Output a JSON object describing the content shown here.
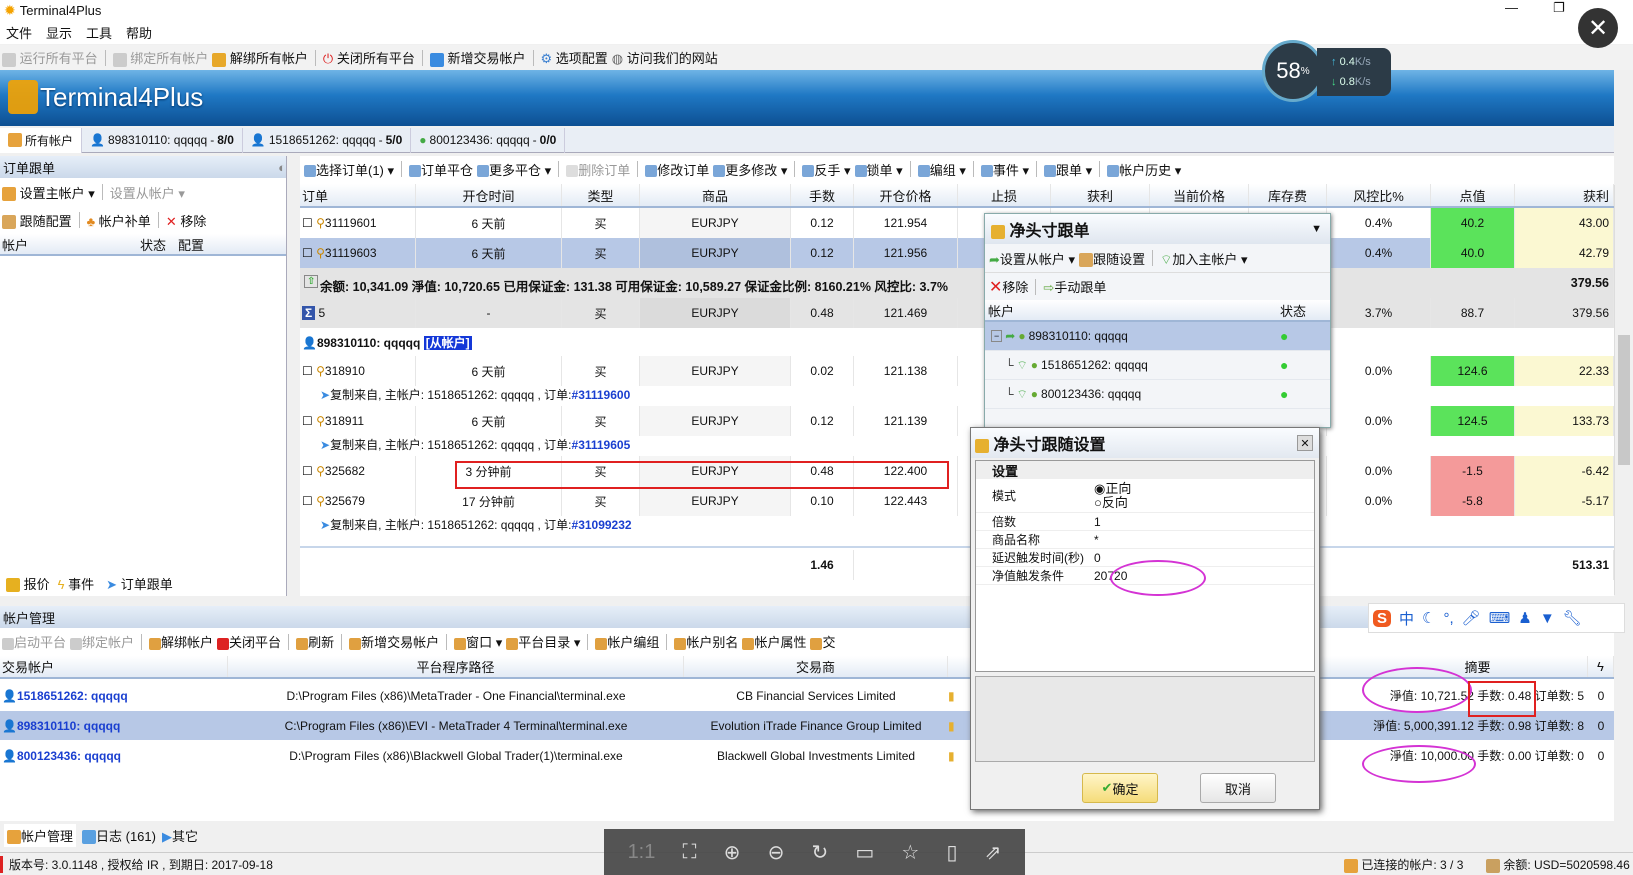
{
  "window": {
    "title": "Terminal4Plus",
    "logo_text": "Terminal4Plus"
  },
  "menu": [
    "文件",
    "显示",
    "工具",
    "帮助"
  ],
  "toolbar": [
    {
      "label": "运行所有平台",
      "disabled": true
    },
    {
      "label": "绑定所有帐户",
      "disabled": true
    },
    {
      "label": "解绑所有帐户"
    },
    {
      "label": "关闭所有平台"
    },
    {
      "label": "新增交易帐户"
    },
    {
      "label": "选项配置"
    },
    {
      "label": "访问我们的网站"
    }
  ],
  "net_widget": {
    "percent": "58",
    "percent_unit": "%",
    "up": "0.4",
    "down": "0.8",
    "unit": "K/s"
  },
  "account_tabs": [
    {
      "label": "所有帐户"
    },
    {
      "label": "898310110: qqqqq",
      "count": "8/0"
    },
    {
      "label": "1518651262: qqqqq",
      "count": "5/0"
    },
    {
      "label": "800123436: qqqqq",
      "count": "0/0"
    }
  ],
  "left_panel": {
    "title": "订单跟单",
    "set_master": "设置主帐户",
    "set_slave": "设置从帐户",
    "follow_config": "跟随配置",
    "account_fill": "帐户补单",
    "remove": "移除",
    "columns": [
      "帐户",
      "状态",
      "配置"
    ],
    "bottom_tabs": [
      "报价",
      "事件",
      "订单跟单"
    ]
  },
  "orders_toolbar": [
    "选择订单(1)",
    "订单平仓",
    "更多平仓",
    "删除订单",
    "修改订单",
    "更多修改",
    "反手",
    "锁单",
    "编组",
    "事件",
    "跟单",
    "帐户历史"
  ],
  "orders_columns": [
    "订单",
    "开仓时间",
    "类型",
    "商品",
    "手数",
    "开仓价格",
    "止损",
    "获利",
    "当前价格",
    "库存费",
    "风控比%",
    "点值",
    "获利"
  ],
  "orders": [
    {
      "id": "31119601",
      "time": "6 天前",
      "type": "买",
      "symbol": "EURJPY",
      "lots": "0.12",
      "price": "121.954",
      "risk": "0.4%",
      "points": "40.2",
      "profit": "43.00",
      "points_color": "green"
    },
    {
      "id": "31119603",
      "time": "6 天前",
      "type": "买",
      "symbol": "EURJPY",
      "lots": "0.12",
      "price": "121.956",
      "risk": "0.4%",
      "points": "40.0",
      "profit": "42.79",
      "points_color": "green",
      "selected": true
    }
  ],
  "summary": {
    "text": "余额: 10,341.09  淨值: 10,720.65  已用保证金: 131.38  可用保证金: 10,589.27  保证金比例: 8160.21%  风控比: 3.7%",
    "profit": "379.56"
  },
  "sigma_row": {
    "id": "5",
    "time": "-",
    "type": "买",
    "symbol": "EURJPY",
    "lots": "0.48",
    "price": "121.469",
    "risk": "3.7%",
    "points": "88.7",
    "profit": "379.56"
  },
  "slave_account": {
    "label": "898310110: qqqqq",
    "tag": "[从帐户]"
  },
  "slave_orders": [
    {
      "id": "318910",
      "time": "6 天前",
      "type": "买",
      "symbol": "EURJPY",
      "lots": "0.02",
      "price": "121.138",
      "risk": "0.0%",
      "points": "124.6",
      "profit": "22.33",
      "points_color": "green",
      "copy": "复制来自, 主帐户: 1518651262: qqqqq , 订单:",
      "copy_ref": "#31119600"
    },
    {
      "id": "318911",
      "time": "6 天前",
      "type": "买",
      "symbol": "EURJPY",
      "lots": "0.12",
      "price": "121.139",
      "risk": "0.0%",
      "points": "124.5",
      "profit": "133.73",
      "points_color": "green",
      "copy": "复制来自, 主帐户: 1518651262: qqqqq , 订单:",
      "copy_ref": "#31119605"
    },
    {
      "id": "325682",
      "time": "3 分钟前",
      "type": "买",
      "symbol": "EURJPY",
      "lots": "0.48",
      "price": "122.400",
      "risk": "0.0%",
      "points": "-1.5",
      "profit": "-6.42",
      "points_color": "red"
    },
    {
      "id": "325679",
      "time": "17 分钟前",
      "type": "买",
      "symbol": "EURJPY",
      "lots": "0.10",
      "price": "122.443",
      "risk": "0.0%",
      "points": "-5.8",
      "profit": "-5.17",
      "points_color": "red",
      "copy": "复制来自, 主帐户: 1518651262: qqqqq , 订单:",
      "copy_ref": "#31099232"
    }
  ],
  "orders_total": {
    "lots": "1.46",
    "profit": "513.31"
  },
  "net_panel": {
    "title": "净头寸跟单",
    "set_slave": "设置从帐户",
    "follow_settings": "跟随设置",
    "add_master": "加入主帐户",
    "remove": "移除",
    "manual": "手动跟单",
    "columns": [
      "帐户",
      "状态"
    ],
    "tree": [
      {
        "label": "898310110: qqqqq",
        "level": 0
      },
      {
        "label": "1518651262: qqqqq",
        "level": 1
      },
      {
        "label": "800123436: qqqqq",
        "level": 1
      }
    ]
  },
  "dialog": {
    "title": "净头寸跟随设置",
    "section": "设置",
    "rows": [
      {
        "label": "模式"
      },
      {
        "label": "倍数",
        "value": "1"
      },
      {
        "label": "商品名称",
        "value": "*"
      },
      {
        "label": "延迟触发时间(秒)",
        "value": "0"
      },
      {
        "label": "净值触发条件",
        "value": "20720"
      }
    ],
    "mode_options": [
      {
        "label": "正向",
        "checked": true
      },
      {
        "label": "反向",
        "checked": false
      }
    ],
    "ok": "确定",
    "cancel": "取消"
  },
  "account_mgmt": {
    "title": "帐户管理",
    "toolbar": [
      {
        "label": "启动平台",
        "disabled": true
      },
      {
        "label": "绑定帐户",
        "disabled": true
      },
      {
        "label": "解绑帐户"
      },
      {
        "label": "关闭平台"
      },
      {
        "label": "刷新"
      },
      {
        "label": "新增交易帐户"
      },
      {
        "label": "窗口"
      },
      {
        "label": "平台目录"
      },
      {
        "label": "帐户编组"
      },
      {
        "label": "帐户别名"
      },
      {
        "label": "帐户属性"
      },
      {
        "label": "交"
      }
    ],
    "columns": [
      "交易帐户",
      "平台程序路径",
      "交易商",
      "摘要"
    ],
    "rows": [
      {
        "account": "1518651262: qqqqq",
        "path": "D:\\Program Files (x86)\\MetaTrader - One Financial\\terminal.exe",
        "broker": "CB Financial Services Limited",
        "summary": "淨值: 10,721.52  手数: 0.48  订单数: 5",
        "last": "0"
      },
      {
        "account": "898310110: qqqqq",
        "path": "C:\\Program Files (x86)\\EVI - MetaTrader 4 Terminal\\terminal.exe",
        "broker": "Evolution iTrade Finance Group Limited",
        "summary": "淨值: 5,000,391.12  手数: 0.98  订单数: 8",
        "last": "0",
        "selected": true
      },
      {
        "account": "800123436: qqqqq",
        "path": "D:\\Program Files (x86)\\Blackwell Global Trader(1)\\terminal.exe",
        "broker": "Blackwell Global Investments Limited",
        "summary": "淨值: 10,000.00  手数: 0.00  订单数: 0",
        "last": "0"
      }
    ]
  },
  "ime_bar": {
    "label": "中"
  },
  "bottom_tabs": [
    "帐户管理",
    "日志 (161)",
    "其它"
  ],
  "viewer_toolbar": {
    "one_to_one": "1:1",
    "icons": [
      "fit-icon",
      "zoom-in-icon",
      "zoom-out-icon",
      "rotate-icon",
      "save-icon",
      "bookmark-icon",
      "device-icon",
      "share-icon"
    ]
  },
  "status": {
    "version": "版本号: 3.0.1148 , 授权给 IR , 到期日: 2017-09-18",
    "connected": "已连接的帐户: 3 / 3",
    "balance": "余额: USD=5020598.46"
  },
  "colors": {
    "selected": "#b7c8e6",
    "points_positive": "#5be35b",
    "points_negative": "#f49a9a",
    "profit_bg": "#fbf8d2",
    "annotation": "#d433d4",
    "highlight": "#e02020"
  }
}
